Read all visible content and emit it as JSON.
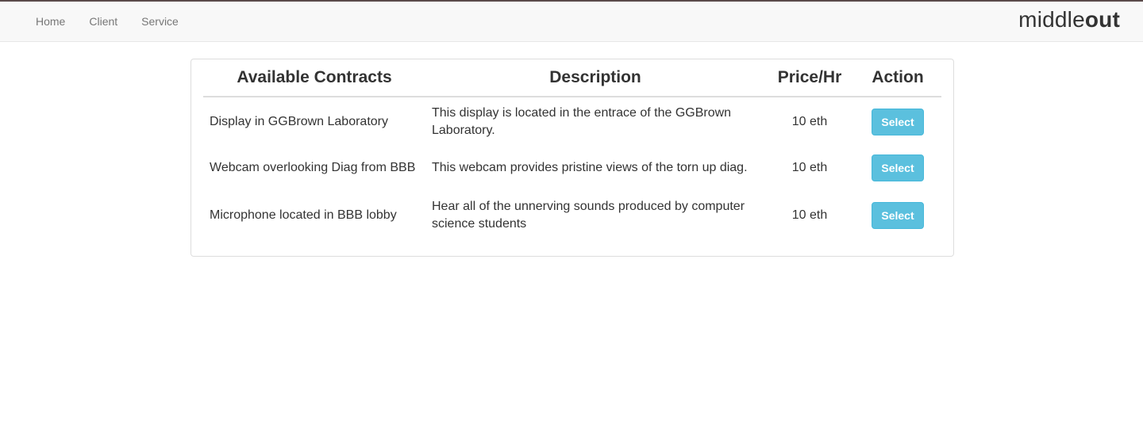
{
  "nav": {
    "links": [
      "Home",
      "Client",
      "Service"
    ],
    "brand_light": "middle",
    "brand_bold": "out"
  },
  "table": {
    "headers": {
      "name": "Available Contracts",
      "description": "Description",
      "price": "Price/Hr",
      "action": "Action"
    },
    "rows": [
      {
        "name": "Display in GGBrown Laboratory",
        "description": "This display is located in the entrace of the GGBrown Laboratory.",
        "price": "10 eth",
        "action_label": "Select"
      },
      {
        "name": "Webcam overlooking Diag from BBB",
        "description": "This webcam provides pristine views of the torn up diag.",
        "price": "10 eth",
        "action_label": "Select"
      },
      {
        "name": "Microphone located in BBB lobby",
        "description": "Hear all of the unnerving sounds produced by computer science students",
        "price": "10 eth",
        "action_label": "Select"
      }
    ]
  },
  "colors": {
    "button_bg": "#5bc0de",
    "navbar_bg": "#f8f8f8",
    "text": "#333333"
  }
}
